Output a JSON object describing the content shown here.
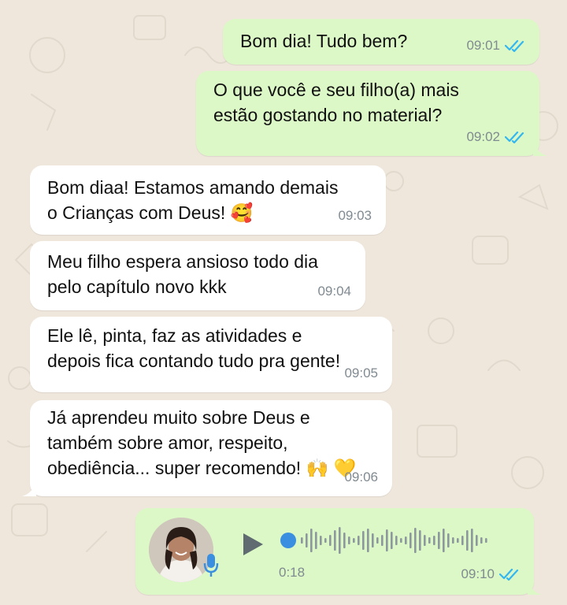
{
  "colors": {
    "outgoing_bubble": "#dcf8c6",
    "incoming_bubble": "#ffffff",
    "wallpaper": "#efe7dc",
    "read_ticks": "#34b7f1",
    "voice_dot": "#3a8fe0",
    "timestamp": "#808a91"
  },
  "messages": [
    {
      "direction": "outgoing",
      "text": "Bom dia! Tudo bem?",
      "time": "09:01",
      "status": "read"
    },
    {
      "direction": "outgoing",
      "text": "O que você e seu filho(a) mais\nestão gostando no material?",
      "time": "09:02",
      "status": "read"
    },
    {
      "direction": "incoming",
      "text": "Bom diaa! Estamos amando demais\no Crianças com Deus! 🥰",
      "time": "09:03"
    },
    {
      "direction": "incoming",
      "text": "Meu filho espera ansioso todo dia\npelo capítulo novo kkk",
      "time": "09:04"
    },
    {
      "direction": "incoming",
      "text": "Ele lê, pinta, faz as atividades e\ndepois fica contando tudo pra gente!",
      "time": "09:05"
    },
    {
      "direction": "incoming",
      "text": "Já aprendeu muito sobre Deus e\ntambém sobre amor, respeito,\nobediência... super recomendo! 🙌 💛",
      "time": "09:06"
    }
  ],
  "voice_note": {
    "direction": "outgoing",
    "duration": "0:18",
    "time": "09:10",
    "status": "read",
    "progress": 0,
    "icons": [
      "play-icon",
      "mic-icon",
      "double-check-icon"
    ]
  }
}
